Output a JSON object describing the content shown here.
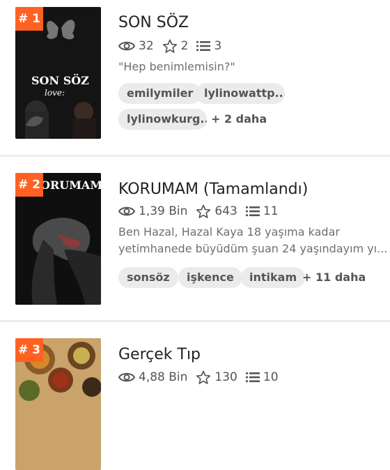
{
  "stories": [
    {
      "rank": "# 1",
      "title": "SON SÖZ",
      "cover_title": "SON SÖZ",
      "cover_subtitle": "love:",
      "views": "32",
      "votes": "2",
      "parts": "3",
      "description": "\"Hep benimlemisin?\"",
      "tags": [
        "emilymiler",
        "lylinowattp...",
        "lylinowkurg..."
      ],
      "more": "+ 2 daha"
    },
    {
      "rank": "# 2",
      "title": "KORUMAM (Tamamlandı)",
      "cover_title": "ORUMAM",
      "views": "1,39 Bin",
      "votes": "643",
      "parts": "11",
      "description_line1": "Ben Hazal, Hazal Kaya 18 yaşıma kadar",
      "description_line2": "yetimhanede büyüdüm şuan 24 yaşındayım yı...",
      "tags": [
        "sonsöz",
        "işkence",
        "intikam"
      ],
      "more": "+ 11 daha"
    },
    {
      "rank": "# 3",
      "title": "Gerçek Tıp",
      "views": "4,88 Bin",
      "votes": "130",
      "parts": "10"
    }
  ],
  "icons": {
    "views": "eye-icon",
    "votes": "star-icon",
    "parts": "list-icon"
  },
  "colors": {
    "rank_badge": "#ff6122",
    "tag_bg": "#ebebeb"
  }
}
